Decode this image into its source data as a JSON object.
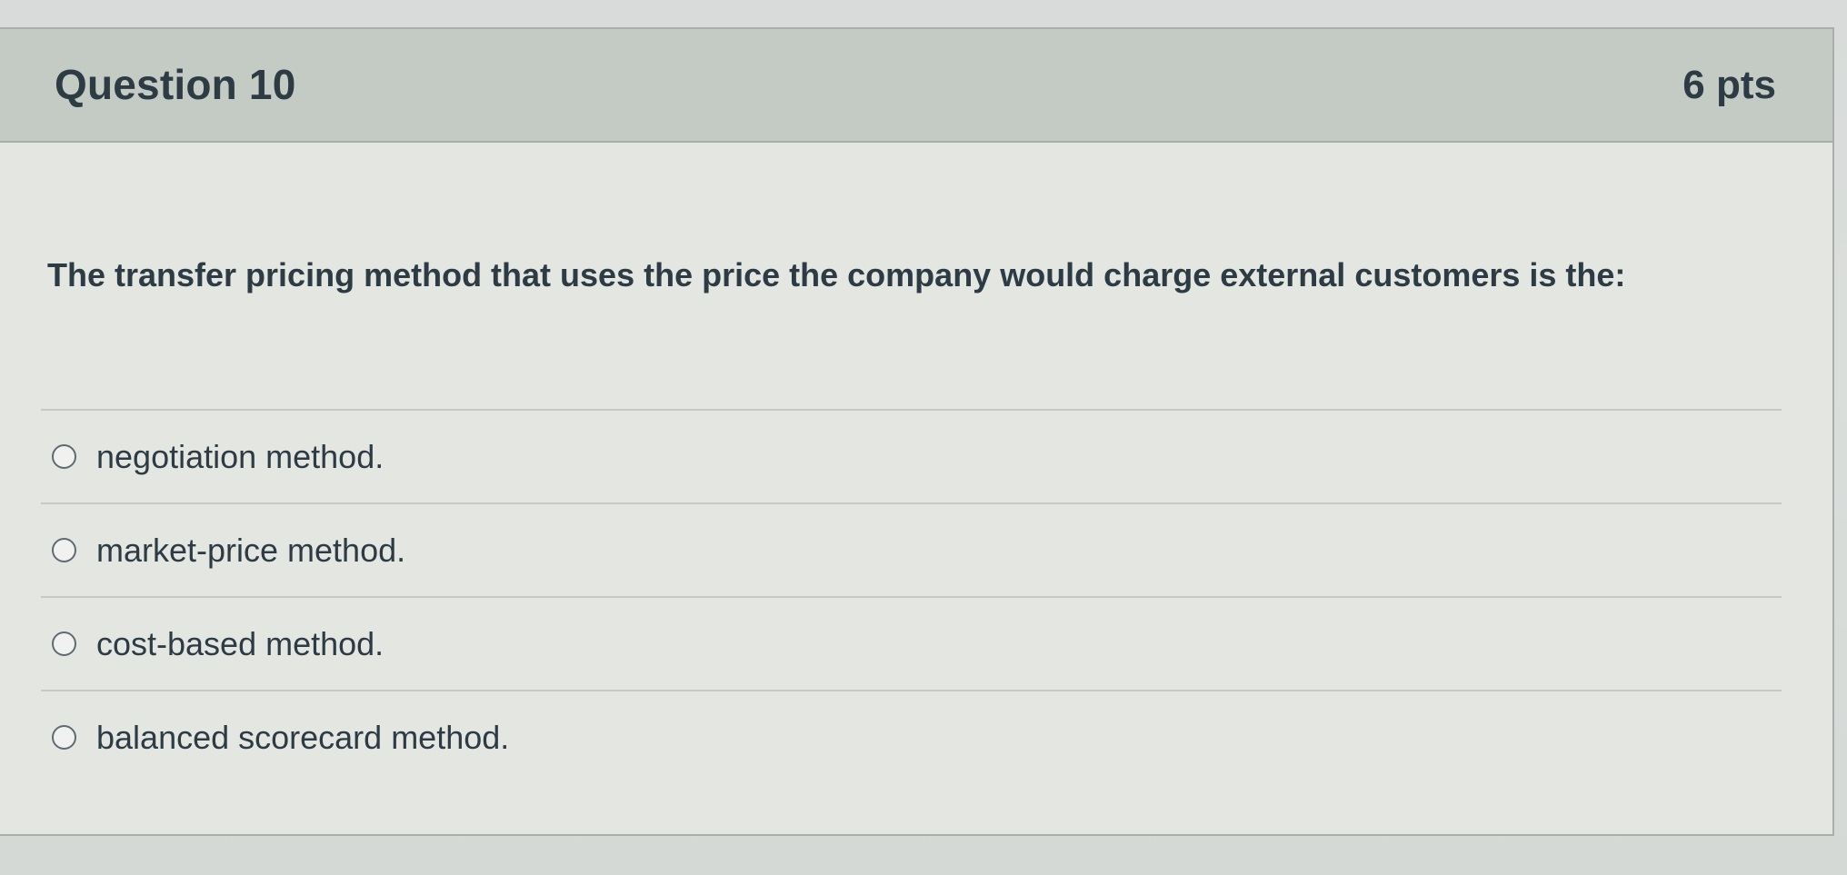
{
  "question": {
    "title": "Question 10",
    "points": "6 pts",
    "text": "The transfer pricing method that uses the price the company would charge external customers is the:",
    "answers": [
      {
        "label": "negotiation method."
      },
      {
        "label": "market-price method."
      },
      {
        "label": "cost-based method."
      },
      {
        "label": "balanced scorecard method."
      }
    ]
  },
  "colors": {
    "header_background": "#c4cbc4",
    "card_background": "#e4e6e2",
    "text": "#2d3b45"
  },
  "icons": {
    "answer_marker": "radio-button-icon"
  }
}
